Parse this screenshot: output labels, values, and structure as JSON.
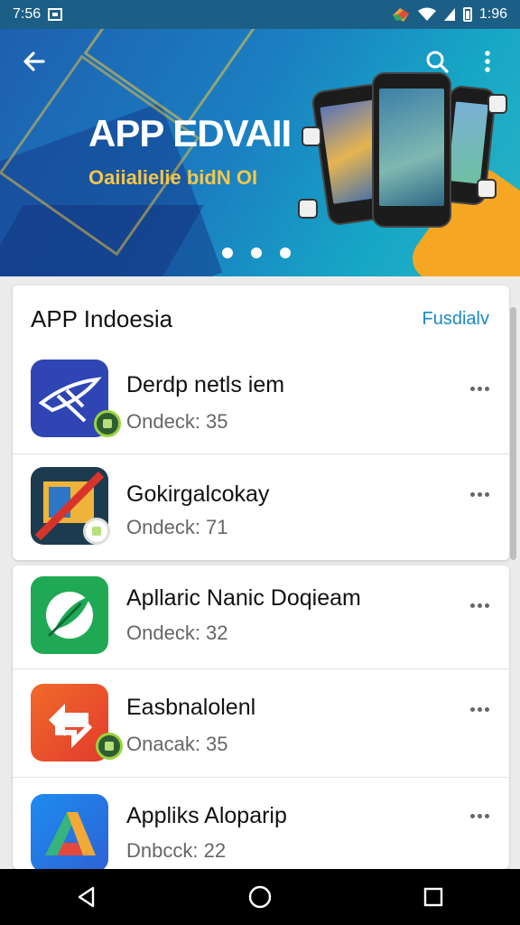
{
  "status_bar": {
    "time": "7:56",
    "right_text": "1:96"
  },
  "banner": {
    "title": "APP EDVAII",
    "subtitle": "Oaiialielie bidN OI",
    "active_slide": 2,
    "slide_count": 3
  },
  "section": {
    "title": "APP Indoesia",
    "link": "Fusdialv"
  },
  "apps": [
    {
      "name": "Derdp netls iem",
      "meta": "Ondeck: 35",
      "icon": "feather-app-icon"
    },
    {
      "name": "Gokirgalcokay",
      "meta": "Ondeck: 71",
      "icon": "slash-app-icon"
    },
    {
      "name": "Apllaric Nanic Doqieam",
      "meta": "Ondeck: 32",
      "icon": "leaf-app-icon"
    },
    {
      "name": "Easbnalolenl",
      "meta": "Onacak: 35",
      "icon": "arrows-app-icon"
    },
    {
      "name": "Appliks Aloparip",
      "meta": "Dnbcck: 22",
      "icon": "triangle-app-icon"
    }
  ],
  "colors": {
    "accent": "#1a8ac4",
    "banner_start": "#1e5fb0",
    "banner_end": "#2bb4c4",
    "status_bar": "#1c5f86",
    "nav_bar": "#000000"
  }
}
